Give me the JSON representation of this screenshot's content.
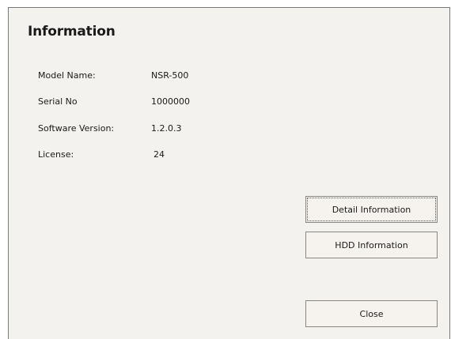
{
  "dialog": {
    "title": "Information",
    "fields": [
      {
        "label": "Model Name:",
        "value": "NSR-500"
      },
      {
        "label": "Serial No",
        "value": "1000000"
      },
      {
        "label": "Software Version:",
        "value": "1.2.0.3"
      },
      {
        "label": "License:",
        "value": "24"
      }
    ],
    "buttons": {
      "detail_label": "Detail Information",
      "hdd_label": "HDD Information",
      "close_label": "Close"
    }
  },
  "colors": {
    "dialog_background": "#f4f2ee",
    "button_background": "#f6f3ef",
    "border": "#7a7a7a"
  }
}
